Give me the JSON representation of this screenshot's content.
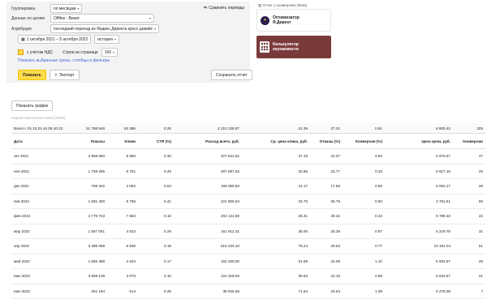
{
  "filters": {
    "grouping_label": "Группировка",
    "grouping_value": "по месяцам",
    "goal_data_label": "Данные по целям",
    "goal_data_value": "Offline : Визит",
    "attribution_label": "Атрибуция",
    "attribution_value": "последний переход из Яндекс.Директа кросс девайс",
    "date_range": "1 октября 2021 – 5 октября 2022",
    "history_value": "история",
    "vat_label": "с учётом НДС",
    "rows_label": "Строк на странице",
    "rows_value": "100",
    "selected_link": "Показать выбранные срезы, столбцы и фильтры",
    "compare_label": "Сравнить периоды",
    "show_button": "Показать",
    "export_button": "Экспорт",
    "save_button": "Сохранить отчет"
  },
  "sidebar": {
    "report_link": "Отчет о конверсиях (Beta)",
    "card1_title_line1": "Оптимизатор",
    "card1_title_line2": "Я.Директ",
    "card2_title_line1": "Калькулятор",
    "card2_title_line2": "окупаемости"
  },
  "show_graph_button": "Показать график",
  "inactive_hint": "Недействительная клика (0000)",
  "table": {
    "total_label": "Всего с 01.10.21 по 05.10.22",
    "total": [
      "21 788 548",
      "53 386",
      "0.25",
      "2 210 138,97",
      "41.39",
      "27.31",
      "0.61",
      "6 800.43",
      "325"
    ],
    "headers": [
      "Дата",
      "Показы",
      "Клики",
      "CTR (%)",
      "Расход всего, руб.",
      "Ср. цена клика, руб.",
      "Отказы (%)",
      "Конверсия (%)",
      "Цена цели, руб.",
      "Конверсии"
    ],
    "rows": [
      [
        "окт 2021",
        "2 958 860",
        "8 860",
        "0.30",
        "327 621,62",
        "37.16",
        "24.07",
        "0.53",
        "6 970.67",
        "47"
      ],
      [
        "ноя 2021",
        "1 769 295",
        "8 751",
        "0.49",
        "287 697,53",
        "32.86",
        "23.77",
        "0.33",
        "9 917.16",
        "29"
      ],
      [
        "дек 2021",
        "769 202",
        "4 082",
        "0.53",
        "169 060,63",
        "41.17",
        "17.55",
        "0.69",
        "6 002.17",
        "28"
      ],
      [
        "янв 2022",
        "1 591 400",
        "6 766",
        "0.41",
        "221 905,04",
        "33.70",
        "25.79",
        "0.90",
        "3 761.61",
        "59"
      ],
      [
        "фев 2022",
        "4 779 743",
        "7 684",
        "0.16",
        "202 131,59",
        "26.31",
        "28.34",
        "0.43",
        "6 788.33",
        "23"
      ],
      [
        "мар 2022",
        "1 587 061",
        "4 623",
        "0.29",
        "161 812,31",
        "35.00",
        "33.29",
        "0.67",
        "5 219.75",
        "31"
      ],
      [
        "апр 2022",
        "3 485 058",
        "6 636",
        "0.19",
        "519 233,10",
        "78.24",
        "29.52",
        "0.77",
        "10 181.04",
        "51"
      ],
      [
        "май 2022",
        "1 565 488",
        "2 634",
        "0.17",
        "162 200,00",
        "61.69",
        "22.09",
        "1.10",
        "5 603.57",
        "29"
      ],
      [
        "июн 2022",
        "3 969 149",
        "3 070",
        "0.10",
        "122 318,03",
        "39.84",
        "31.15",
        "0.68",
        "5 624.67",
        "21"
      ],
      [
        "июл 2022",
        "261 184",
        "514",
        "0.26",
        "38 925,56",
        "71.84",
        "23.54",
        "1.39",
        "5 275.08",
        "7"
      ]
    ]
  },
  "colors": {
    "accent": "#ffdb4d",
    "card2_bg": "#7b3a3a",
    "link": "#3f6ad8"
  }
}
